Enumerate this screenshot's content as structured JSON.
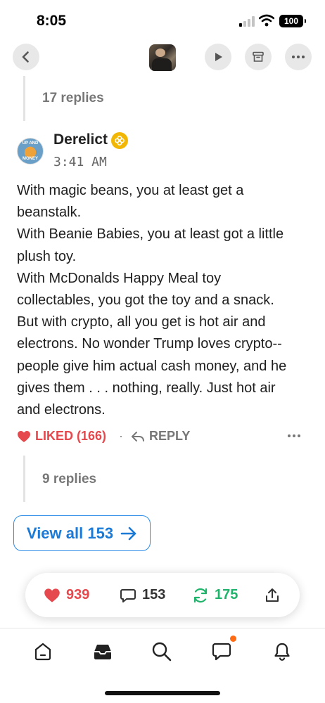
{
  "status_bar": {
    "time": "8:05",
    "battery": "100"
  },
  "nav": {
    "back_icon": "chevron-left-icon",
    "play_icon": "play-icon",
    "archive_icon": "archive-icon",
    "more_icon": "ellipsis-icon"
  },
  "thread_top": {
    "replies_label": "17 replies"
  },
  "comment": {
    "author": "Derelict",
    "avatar_text_top": "UP AND",
    "avatar_text_bottom": "MONEY",
    "timestamp": "3:41 AM",
    "body": "With magic beans, you at least get a\nbeanstalk.\nWith Beanie Babies, you at least got a little\nplush toy.\nWith McDonalds Happy Meal toy\ncollectables, you got the toy and a snack.\nBut with crypto, all you get is hot air and\nelectrons. No wonder Trump loves crypto--\npeople give him actual cash money, and he\ngives them . . . nothing, really. Just hot air\nand electrons.",
    "liked_label": "LIKED (166)",
    "separator": "·",
    "reply_label": "REPLY",
    "nested_replies_label": "9 replies"
  },
  "view_all": {
    "label": "View all 153"
  },
  "floating_bar": {
    "likes": "939",
    "comments": "153",
    "restacks": "175"
  },
  "colors": {
    "like_red": "#e5484d",
    "link_blue": "#1b7ad6",
    "restack_green": "#1fb36b",
    "badge_yellow": "#f2b705",
    "notification_orange": "#ff6a14"
  },
  "tabs": [
    "home-icon",
    "inbox-icon",
    "search-icon",
    "chat-icon",
    "bell-icon"
  ]
}
